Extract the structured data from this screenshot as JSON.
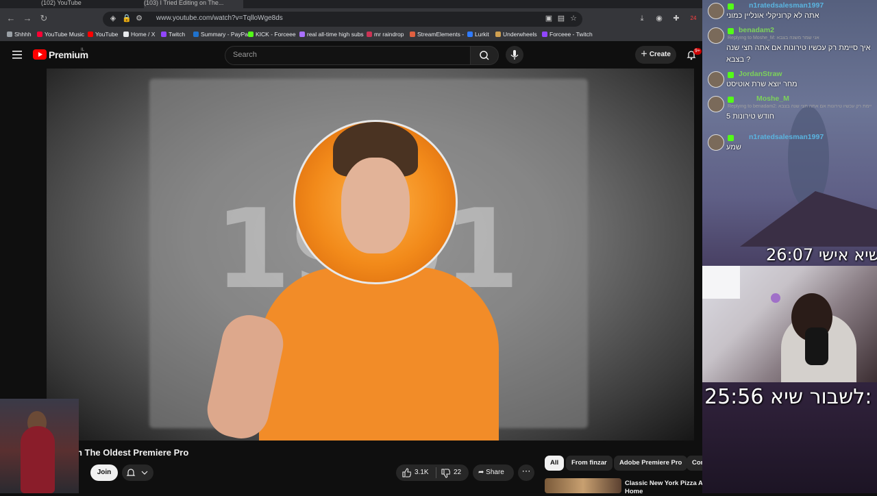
{
  "browser": {
    "tabs": [
      {
        "label": "(102) YouTube"
      },
      {
        "label": "(103) I Tried Editing on The..."
      }
    ],
    "url": "www.youtube.com/watch?v=TqlloWge8ds",
    "extension_badge": "24",
    "bookmarks": [
      {
        "label": "Shhhh",
        "color": "#9aa0a6"
      },
      {
        "label": "YouTube Music",
        "color": "#ff0033"
      },
      {
        "label": "YouTube",
        "color": "#ff0000"
      },
      {
        "label": "Home / X",
        "color": "#e8eaed"
      },
      {
        "label": "Twitch",
        "color": "#9146ff"
      },
      {
        "label": "Summary - PayPal",
        "color": "#1f72cd"
      },
      {
        "label": "KICK - Forceee",
        "color": "#53fc18"
      },
      {
        "label": "real all-time high subs",
        "color": "#a970ff"
      },
      {
        "label": "mr raindrop",
        "color": "#cc3355"
      },
      {
        "label": "StreamElements -",
        "color": "#e06040"
      },
      {
        "label": "Lurkit",
        "color": "#2f7bff"
      },
      {
        "label": "Underwheels",
        "color": "#d0a050"
      },
      {
        "label": "Forceee - Twitch",
        "color": "#9146ff"
      }
    ]
  },
  "youtube": {
    "logo_text": "Premium",
    "logo_region": "IL",
    "search_placeholder": "Search",
    "create_label": "Create",
    "notification_count": "9+",
    "video_title": "n The Oldest Premiere Pro",
    "join_label": "Join",
    "likes": "3.1K",
    "dislikes": "22",
    "share_label": "Share",
    "chips": [
      {
        "label": "All",
        "active": true
      },
      {
        "label": "From finzar",
        "active": false
      },
      {
        "label": "Adobe Premiere Pro",
        "active": false
      },
      {
        "label": "Com",
        "active": false
      }
    ],
    "recommended": [
      {
        "title": "Classic New York Pizza At Home"
      }
    ],
    "video_bg_text": "1901"
  },
  "chat": {
    "messages": [
      {
        "user": "n1ratedsalesman1997",
        "color": "#5ab4e0",
        "text": "אתה לא קרוניקלי אונליין כמוני",
        "reply": ""
      },
      {
        "user": "benadam2",
        "color": "#7cd25a",
        "text": "איך סיימת רק עכשיו טירונות אם אתה חצי שנה",
        "text2": "בצבא ?",
        "reply": "Replying to Moshe_M: אני שמר משנה בצבא"
      },
      {
        "user": "JordanStraw",
        "color": "#7cd25a",
        "text": "מחר יוצא שרת אוטיסט",
        "reply": ""
      },
      {
        "user": "Moshe_M",
        "color": "#7cd25a",
        "text": "5 חודש טירונות",
        "reply": "Replying to benadam2: איך סיימת רק עכשיו טירונות אם אתה חצי שנה בצבא"
      },
      {
        "user": "n1ratedsalesman1997",
        "color": "#5ab4e0",
        "text": "שמע",
        "reply": ""
      }
    ]
  },
  "overlay": {
    "timer_personal_label": "שיא אישי:",
    "timer_personal_value": "26:07",
    "timer_break_label": "לשבור שיא:",
    "timer_break_value": "25:56"
  }
}
